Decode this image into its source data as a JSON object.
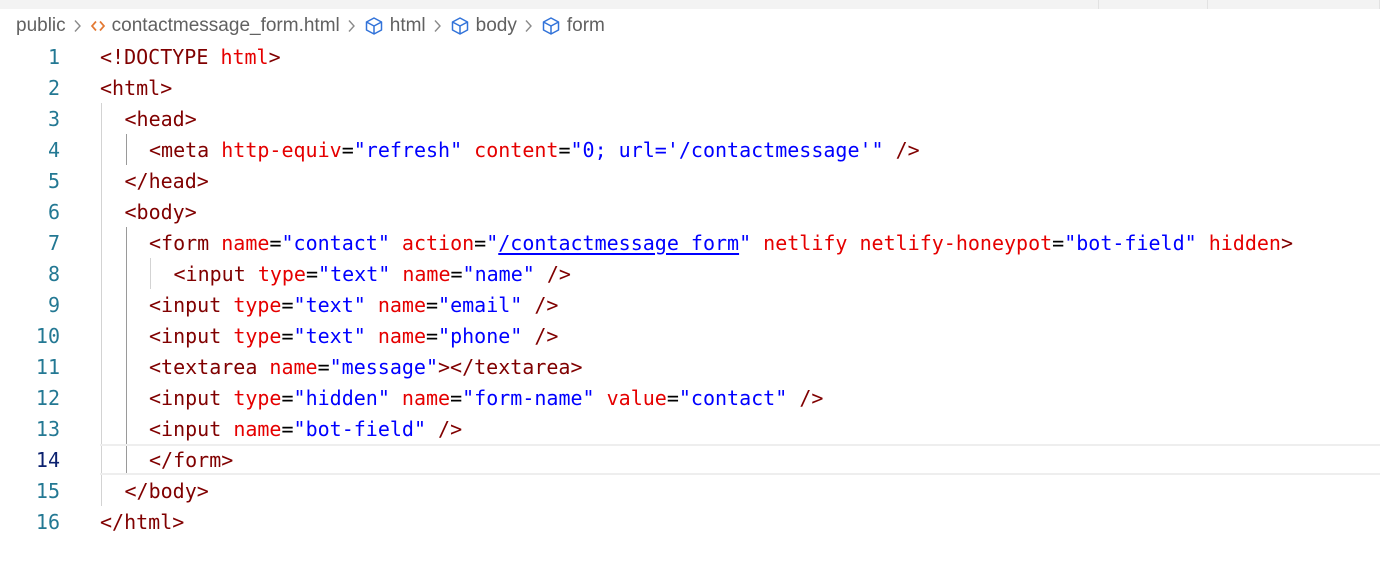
{
  "breadcrumb": {
    "folder": "public",
    "file": "contactmessage_form.html",
    "symbols": [
      "html",
      "body",
      "form"
    ]
  },
  "editor": {
    "current_line": 14,
    "lines": [
      {
        "n": "1",
        "indent": 0,
        "tokens": [
          [
            "punc",
            "<!"
          ],
          [
            "doctype",
            "DOCTYPE"
          ],
          [
            "text",
            " "
          ],
          [
            "attr",
            "html"
          ],
          [
            "punc",
            ">"
          ]
        ]
      },
      {
        "n": "2",
        "indent": 0,
        "tokens": [
          [
            "punc",
            "<"
          ],
          [
            "tag",
            "html"
          ],
          [
            "punc",
            ">"
          ]
        ]
      },
      {
        "n": "3",
        "indent": 1,
        "tokens": [
          [
            "punc",
            "<"
          ],
          [
            "tag",
            "head"
          ],
          [
            "punc",
            ">"
          ]
        ]
      },
      {
        "n": "4",
        "indent": 2,
        "tokens": [
          [
            "punc",
            "<"
          ],
          [
            "tag",
            "meta"
          ],
          [
            "text",
            " "
          ],
          [
            "attr",
            "http-equiv"
          ],
          [
            "eq",
            "="
          ],
          [
            "str",
            "\"refresh\""
          ],
          [
            "text",
            " "
          ],
          [
            "attr",
            "content"
          ],
          [
            "eq",
            "="
          ],
          [
            "str",
            "\"0; url='/contactmessage'\""
          ],
          [
            "text",
            " "
          ],
          [
            "punc",
            "/>"
          ]
        ]
      },
      {
        "n": "5",
        "indent": 1,
        "tokens": [
          [
            "punc",
            "</"
          ],
          [
            "tag",
            "head"
          ],
          [
            "punc",
            ">"
          ]
        ]
      },
      {
        "n": "6",
        "indent": 1,
        "tokens": [
          [
            "punc",
            "<"
          ],
          [
            "tag",
            "body"
          ],
          [
            "punc",
            ">"
          ]
        ]
      },
      {
        "n": "7",
        "indent": 2,
        "tokens": [
          [
            "punc",
            "<"
          ],
          [
            "tag",
            "form"
          ],
          [
            "text",
            " "
          ],
          [
            "attr",
            "name"
          ],
          [
            "eq",
            "="
          ],
          [
            "str",
            "\"contact\""
          ],
          [
            "text",
            " "
          ],
          [
            "attr",
            "action"
          ],
          [
            "eq",
            "="
          ],
          [
            "str",
            "\""
          ],
          [
            "link",
            "/contactmessage_form"
          ],
          [
            "str",
            "\""
          ],
          [
            "text",
            " "
          ],
          [
            "attr",
            "netlify"
          ],
          [
            "text",
            " "
          ],
          [
            "attr",
            "netlify-honeypot"
          ],
          [
            "eq",
            "="
          ],
          [
            "str",
            "\"bot-field\""
          ],
          [
            "text",
            " "
          ],
          [
            "attr",
            "hidden"
          ],
          [
            "punc",
            ">"
          ]
        ]
      },
      {
        "n": "8",
        "indent": 3,
        "tokens": [
          [
            "punc",
            "<"
          ],
          [
            "tag",
            "input"
          ],
          [
            "text",
            " "
          ],
          [
            "attr",
            "type"
          ],
          [
            "eq",
            "="
          ],
          [
            "str",
            "\"text\""
          ],
          [
            "text",
            " "
          ],
          [
            "attr",
            "name"
          ],
          [
            "eq",
            "="
          ],
          [
            "str",
            "\"name\""
          ],
          [
            "text",
            " "
          ],
          [
            "punc",
            "/>"
          ]
        ]
      },
      {
        "n": "9",
        "indent": 2,
        "tokens": [
          [
            "punc",
            "<"
          ],
          [
            "tag",
            "input"
          ],
          [
            "text",
            " "
          ],
          [
            "attr",
            "type"
          ],
          [
            "eq",
            "="
          ],
          [
            "str",
            "\"text\""
          ],
          [
            "text",
            " "
          ],
          [
            "attr",
            "name"
          ],
          [
            "eq",
            "="
          ],
          [
            "str",
            "\"email\""
          ],
          [
            "text",
            " "
          ],
          [
            "punc",
            "/>"
          ]
        ]
      },
      {
        "n": "10",
        "indent": 2,
        "tokens": [
          [
            "punc",
            "<"
          ],
          [
            "tag",
            "input"
          ],
          [
            "text",
            " "
          ],
          [
            "attr",
            "type"
          ],
          [
            "eq",
            "="
          ],
          [
            "str",
            "\"text\""
          ],
          [
            "text",
            " "
          ],
          [
            "attr",
            "name"
          ],
          [
            "eq",
            "="
          ],
          [
            "str",
            "\"phone\""
          ],
          [
            "text",
            " "
          ],
          [
            "punc",
            "/>"
          ]
        ]
      },
      {
        "n": "11",
        "indent": 2,
        "tokens": [
          [
            "punc",
            "<"
          ],
          [
            "tag",
            "textarea"
          ],
          [
            "text",
            " "
          ],
          [
            "attr",
            "name"
          ],
          [
            "eq",
            "="
          ],
          [
            "str",
            "\"message\""
          ],
          [
            "punc",
            "></"
          ],
          [
            "tag",
            "textarea"
          ],
          [
            "punc",
            ">"
          ]
        ]
      },
      {
        "n": "12",
        "indent": 2,
        "tokens": [
          [
            "punc",
            "<"
          ],
          [
            "tag",
            "input"
          ],
          [
            "text",
            " "
          ],
          [
            "attr",
            "type"
          ],
          [
            "eq",
            "="
          ],
          [
            "str",
            "\"hidden\""
          ],
          [
            "text",
            " "
          ],
          [
            "attr",
            "name"
          ],
          [
            "eq",
            "="
          ],
          [
            "str",
            "\"form-name\""
          ],
          [
            "text",
            " "
          ],
          [
            "attr",
            "value"
          ],
          [
            "eq",
            "="
          ],
          [
            "str",
            "\"contact\""
          ],
          [
            "text",
            " "
          ],
          [
            "punc",
            "/>"
          ]
        ]
      },
      {
        "n": "13",
        "indent": 2,
        "tokens": [
          [
            "punc",
            "<"
          ],
          [
            "tag",
            "input"
          ],
          [
            "text",
            " "
          ],
          [
            "attr",
            "name"
          ],
          [
            "eq",
            "="
          ],
          [
            "str",
            "\"bot-field\""
          ],
          [
            "text",
            " "
          ],
          [
            "punc",
            "/>"
          ]
        ]
      },
      {
        "n": "14",
        "indent": 2,
        "tokens": [
          [
            "punc",
            "</"
          ],
          [
            "tag",
            "form"
          ],
          [
            "punc",
            ">"
          ]
        ]
      },
      {
        "n": "15",
        "indent": 1,
        "tokens": [
          [
            "punc",
            "</"
          ],
          [
            "tag",
            "body"
          ],
          [
            "punc",
            ">"
          ]
        ]
      },
      {
        "n": "16",
        "indent": 0,
        "tokens": [
          [
            "punc",
            "</"
          ],
          [
            "tag",
            "html"
          ],
          [
            "punc",
            ">"
          ]
        ]
      }
    ]
  }
}
